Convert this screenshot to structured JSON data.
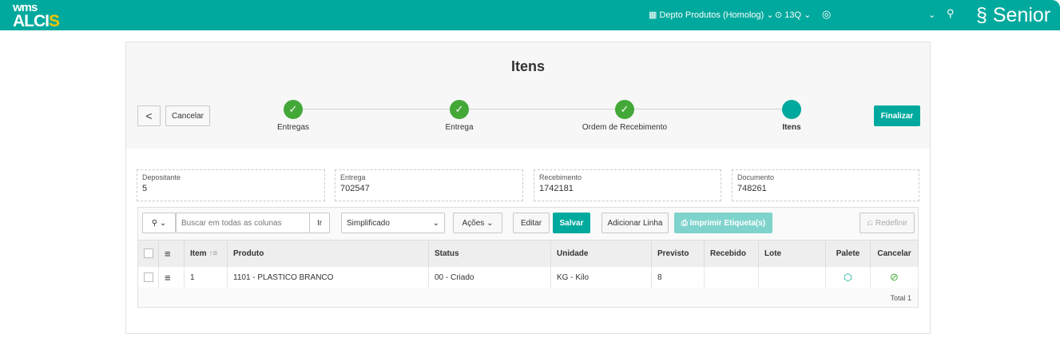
{
  "header": {
    "logo_top": "wms",
    "logo_main": "ALCI",
    "logo_accent": "S",
    "depot": "Depto Produtos (Homolog)",
    "location": "13Q",
    "brand": "Senior"
  },
  "page": {
    "title": "Itens",
    "back_label": "<",
    "cancel_label": "Cancelar",
    "finish_label": "Finalizar"
  },
  "steps": [
    {
      "label": "Entregas",
      "done": true
    },
    {
      "label": "Entrega",
      "done": true
    },
    {
      "label": "Ordem de Recebimento",
      "done": true
    },
    {
      "label": "Itens",
      "done": false
    }
  ],
  "fields": [
    {
      "label": "Depositante",
      "value": "5"
    },
    {
      "label": "Entrega",
      "value": "702547"
    },
    {
      "label": "Recebimento",
      "value": "1742181"
    },
    {
      "label": "Documento",
      "value": "748261"
    }
  ],
  "toolbar": {
    "search_placeholder": "Buscar em todas as colunas",
    "go": "Ir",
    "view": "Simplificado",
    "actions": "Ações",
    "edit": "Editar",
    "save": "Salvar",
    "add_row": "Adicionar Linha",
    "print": "Imprimir Etiqueta(s)",
    "reset": "Redefinir"
  },
  "table": {
    "columns": [
      "Item",
      "Produto",
      "Status",
      "Unidade",
      "Previsto",
      "Recebido",
      "Lote",
      "Palete",
      "Cancelar"
    ],
    "rows": [
      {
        "item": "1",
        "produto": "1101 - PLASTICO BRANCO",
        "status": "00 - Criado",
        "unidade": "KG - Kilo",
        "previsto": "8",
        "recebido": "",
        "lote": ""
      }
    ],
    "total": "Total 1"
  },
  "colors": {
    "brand": "#00a99d",
    "done": "#43a838"
  }
}
